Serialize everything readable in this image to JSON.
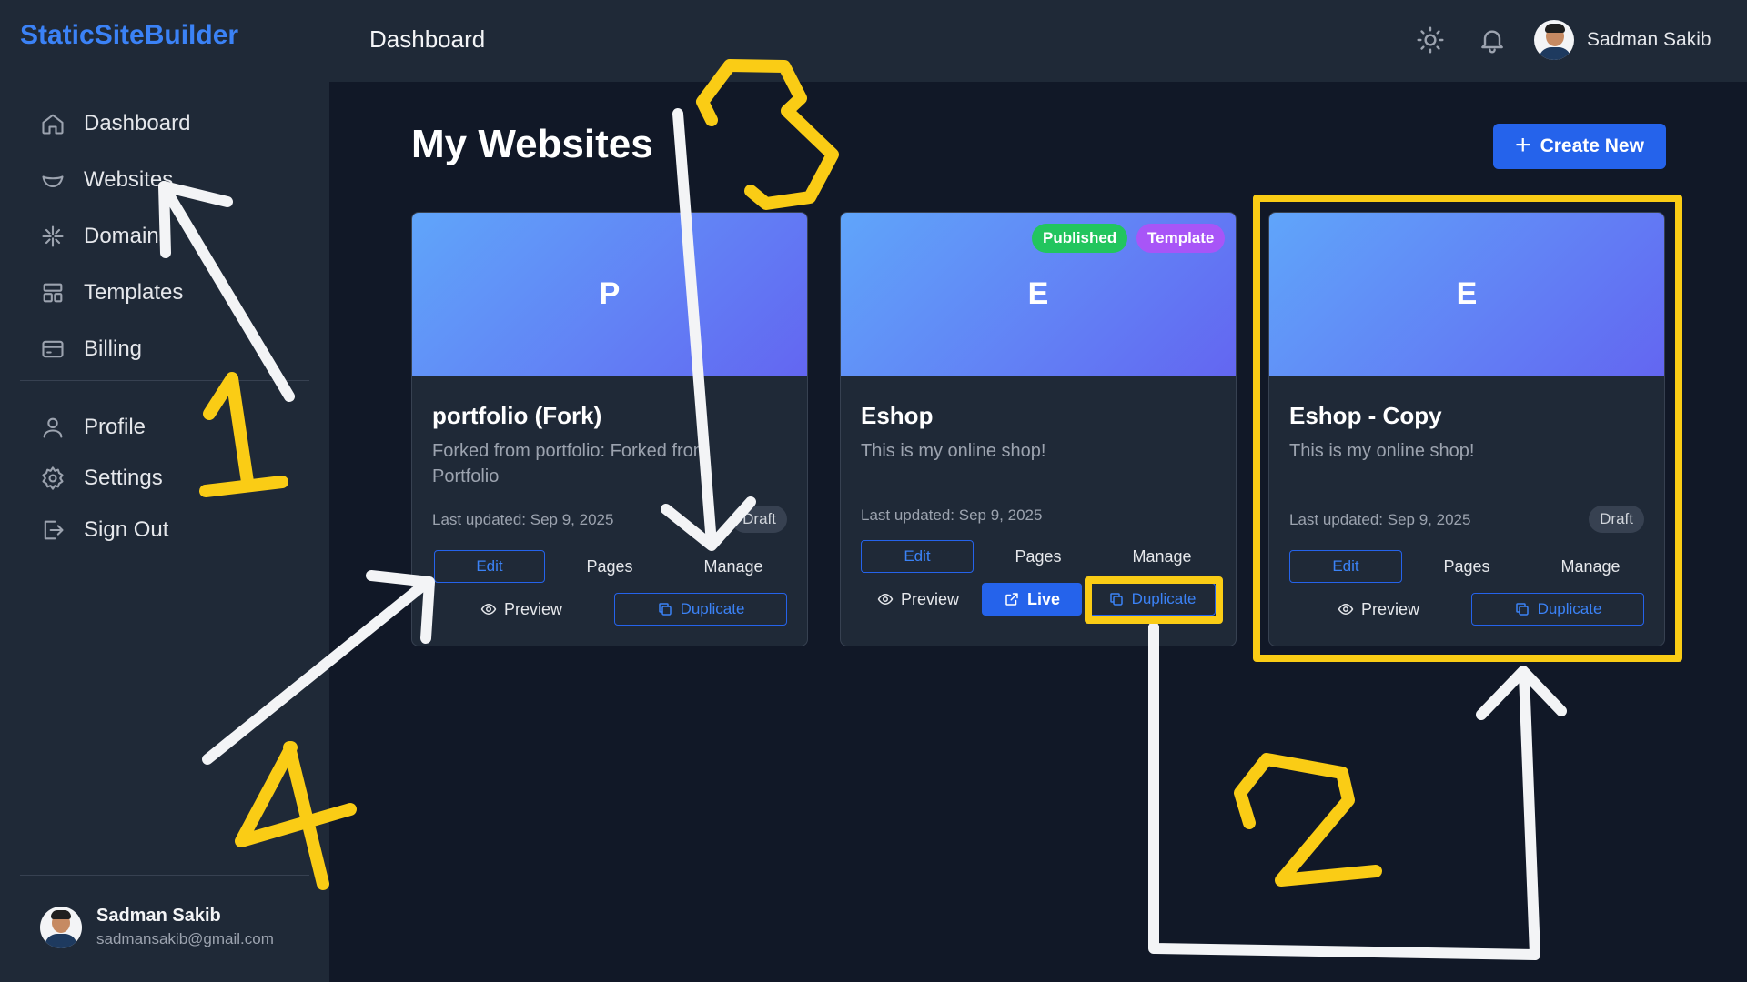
{
  "brand": "StaticSiteBuilder",
  "sidebar": {
    "items": [
      {
        "label": "Dashboard",
        "icon": "home-icon"
      },
      {
        "label": "Websites",
        "icon": "bowl-icon"
      },
      {
        "label": "Domains",
        "icon": "sparkle-icon"
      },
      {
        "label": "Templates",
        "icon": "layout-icon"
      },
      {
        "label": "Billing",
        "icon": "credit-card-icon"
      },
      {
        "label": "Profile",
        "icon": "user-icon"
      },
      {
        "label": "Settings",
        "icon": "gear-icon"
      },
      {
        "label": "Sign Out",
        "icon": "sign-out-icon"
      }
    ],
    "user": {
      "name": "Sadman Sakib",
      "email": "sadmansakib@gmail.com"
    }
  },
  "header": {
    "title": "Dashboard",
    "user_name": "Sadman Sakib"
  },
  "main": {
    "title": "My Websites",
    "create_label": "Create New",
    "cards": [
      {
        "letter": "P",
        "title": "portfolio (Fork)",
        "description": "Forked from portfolio: Forked from Portfolio",
        "updated": "Last updated: Sep 9, 2025",
        "status": "Draft",
        "edit": "Edit",
        "pages": "Pages",
        "manage": "Manage",
        "preview": "Preview",
        "duplicate": "Duplicate"
      },
      {
        "letter": "E",
        "title": "Eshop",
        "description": "This is my online shop!",
        "updated": "Last updated: Sep 9, 2025",
        "badges": [
          "Published",
          "Template"
        ],
        "edit": "Edit",
        "pages": "Pages",
        "manage": "Manage",
        "preview": "Preview",
        "live": "Live",
        "duplicate": "Duplicate"
      },
      {
        "letter": "E",
        "title": "Eshop - Copy",
        "description": "This is my online shop!",
        "updated": "Last updated: Sep 9, 2025",
        "status": "Draft",
        "edit": "Edit",
        "pages": "Pages",
        "manage": "Manage",
        "preview": "Preview",
        "duplicate": "Duplicate"
      }
    ]
  },
  "annotations": {
    "step1": "1",
    "step2": "2",
    "step3": "3",
    "step4": "4",
    "highlight_color": "#facc15",
    "arrow_color": "#f3f4f6"
  }
}
